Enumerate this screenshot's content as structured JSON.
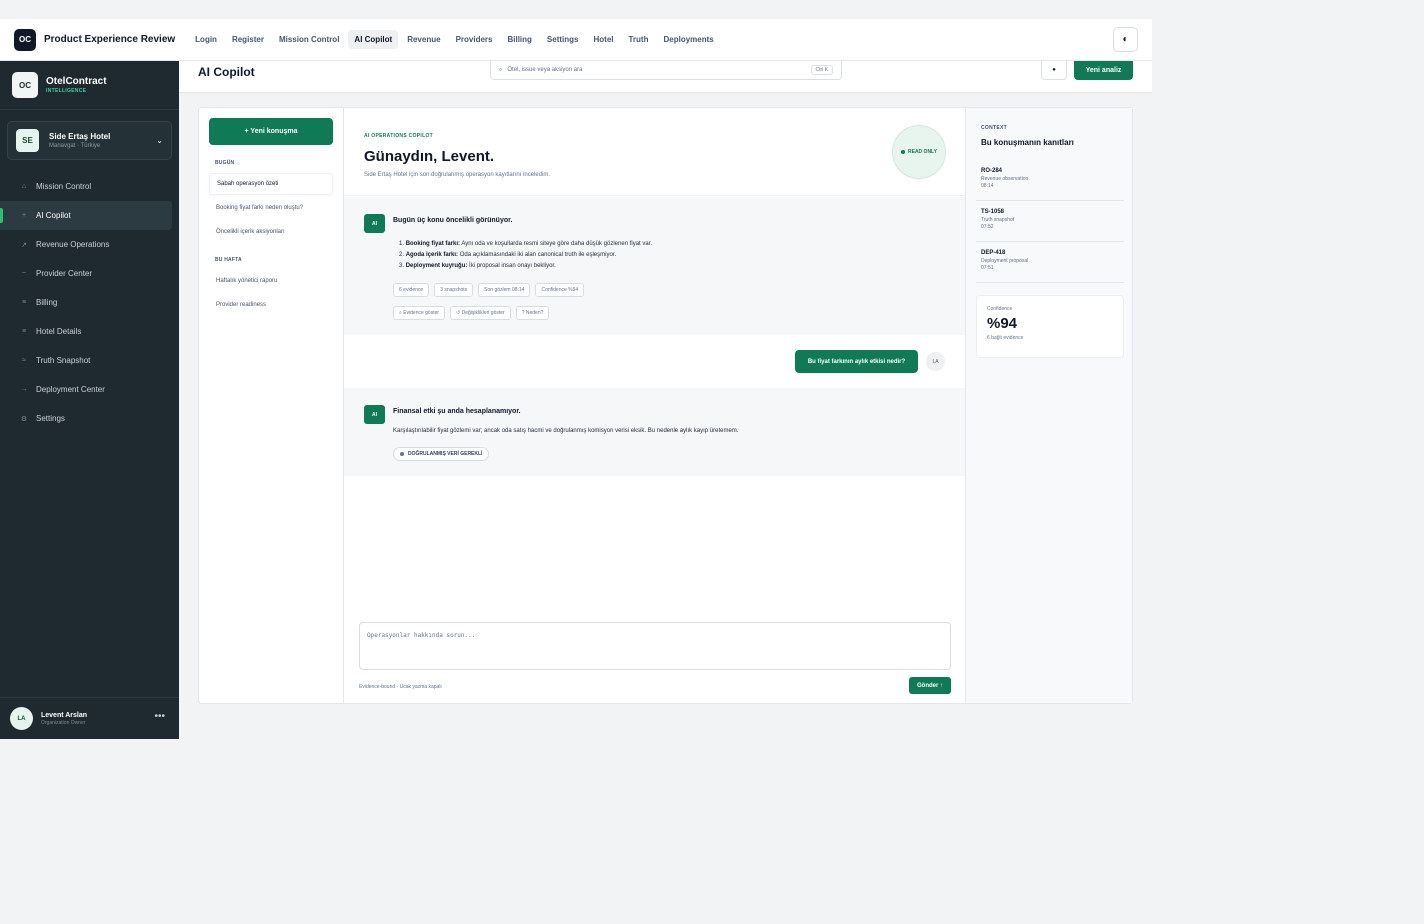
{
  "topbar": {
    "badge": "OC",
    "title": "Product Experience Review",
    "nav": [
      "Login",
      "Register",
      "Mission Control",
      "AI Copilot",
      "Revenue",
      "Providers",
      "Billing",
      "Settings",
      "Hotel",
      "Truth",
      "Deployments"
    ],
    "theme_icon": "◐"
  },
  "sidebar": {
    "logo": "OC",
    "name": "OtelContract",
    "subtitle": "INTELLIGENCE",
    "hotel": {
      "initials": "SE",
      "name": "Side Ertaş Hotel",
      "location": "Manavgat · Türkiye"
    },
    "menu": [
      {
        "icon": "⌂",
        "label": "Mission Control"
      },
      {
        "icon": "+",
        "label": "AI Copilot"
      },
      {
        "icon": "↗",
        "label": "Revenue Operations"
      },
      {
        "icon": "~",
        "label": "Provider Center"
      },
      {
        "icon": "≡",
        "label": "Billing"
      },
      {
        "icon": "≡",
        "label": "Hotel Details"
      },
      {
        "icon": "≈",
        "label": "Truth Snapshot"
      },
      {
        "icon": "→",
        "label": "Deployment Center"
      },
      {
        "icon": "⚙",
        "label": "Settings"
      }
    ],
    "user": {
      "initials": "LA",
      "name": "Levent Arslan",
      "role": "Organization Owner",
      "more": "•••"
    }
  },
  "header": {
    "title": "AI Copilot",
    "search_placeholder": "Otel, issue veya aksiyon ara",
    "search_icon": "⌕",
    "search_kbd": "Ctrl K",
    "dot_icon": "●",
    "new_analysis": "Yeni analiz"
  },
  "conversations": {
    "new_button": "+ Yeni konuşma",
    "section_today": "BUGÜN",
    "today": [
      "Sabah operasyon özeti",
      "Booking fiyat farkı neden oluştu?",
      "Öncelikli içerik aksiyonları"
    ],
    "section_week": "BU HAFTA",
    "week": [
      "Haftalık yönetici raporu",
      "Provider readiness"
    ]
  },
  "chat": {
    "kicker": "AI OPERATIONS COPILOT",
    "greeting": "Günaydın, Levent.",
    "subtitle": "Side Ertaş Hotel için son doğrulanmış operasyon kayıtlarını inceledim.",
    "read_only": "READ ONLY",
    "ai_badge": "AI",
    "msg1": {
      "title": "Bugün üç konu öncelikli görünüyor.",
      "items": [
        {
          "n": "1.",
          "bold": "Booking fiyat farkı:",
          "text": " Aynı oda ve koşullarda resmi siteye göre daha düşük gözlenen fiyat var."
        },
        {
          "n": "2.",
          "bold": "Agoda içerik farkı:",
          "text": " Oda açıklamasındaki iki alan canonical truth ile eşleşmiyor."
        },
        {
          "n": "3.",
          "bold": "Deployment kuyruğu:",
          "text": " İki proposal insan onayı bekliyor."
        }
      ],
      "chips": [
        "6 evidence",
        "3 snapshots",
        "Son gözlem 08:14",
        "Confidence %94"
      ],
      "actions": [
        "⌕ Evidence göster",
        "↺ Değişiklikleri göster",
        "? Neden?"
      ]
    },
    "user_msg": "Bu fiyat farkının aylık etkisi nedir?",
    "user_initials": "LA",
    "msg2": {
      "title": "Finansal etki şu anda hesaplanamıyor.",
      "text": "Karşılaştırılabilir fiyat gözlemi var; ancak oda satış hacmi ve doğrulanmış komisyon verisi eksik. Bu nedenle aylık kayıp üretemem.",
      "chip": "DOĞRULANMIŞ VERİ GEREKLİ"
    },
    "composer_placeholder": "Operasyonlar hakkında sorun...",
    "hint": "Evidence-bound · Ucak yazma kapalı",
    "send": "Gönder ↑"
  },
  "context": {
    "kicker": "CONTEXT",
    "title": "Bu konuşmanın kanıtları",
    "evidence": [
      {
        "id": "RO-284",
        "type": "Revenue observation",
        "time": "08:14"
      },
      {
        "id": "TS-1058",
        "type": "Truth snapshot",
        "time": "07:52"
      },
      {
        "id": "DEP-418",
        "type": "Deployment proposal",
        "time": "07:51"
      }
    ],
    "confidence_label": "Confidence",
    "confidence_value": "%94",
    "confidence_sub": "6 bağlı evidence"
  }
}
